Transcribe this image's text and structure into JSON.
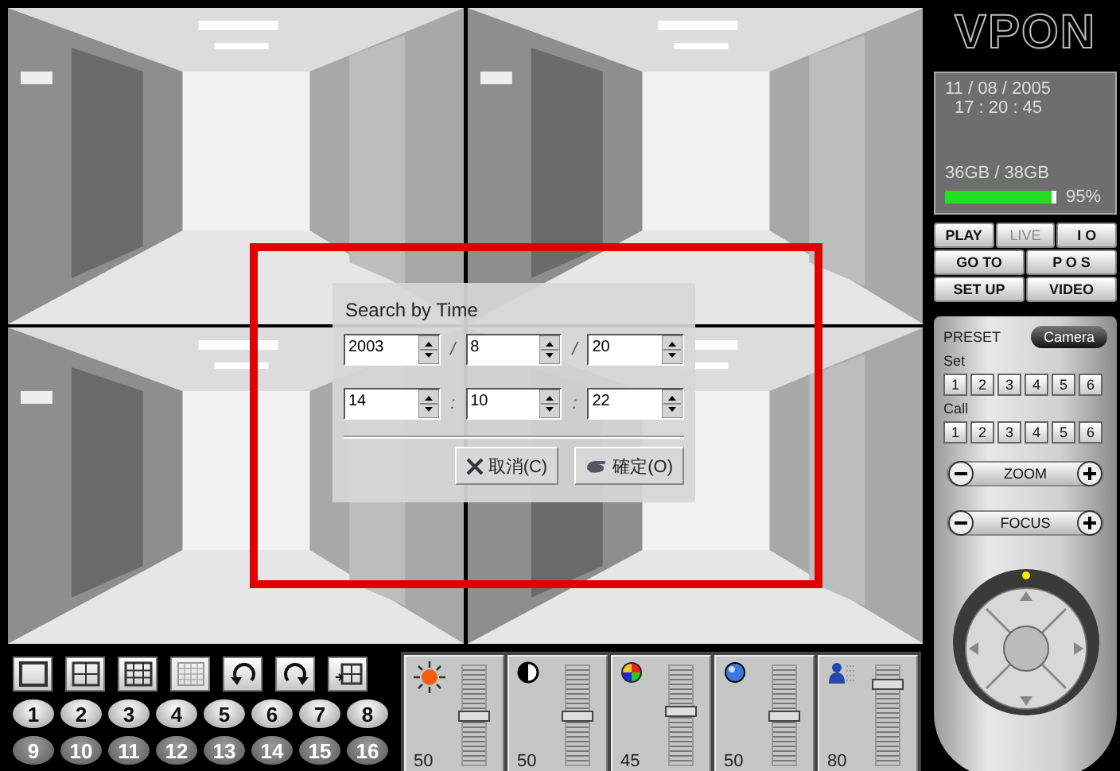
{
  "dialog": {
    "title": "Search by Time",
    "date_fields": [
      "2003",
      "8",
      "20"
    ],
    "date_separators": [
      "/",
      "/"
    ],
    "time_fields": [
      "14",
      "10",
      "22"
    ],
    "time_separators": [
      ":",
      ":"
    ],
    "buttons": [
      {
        "label": "取消(C)",
        "kind": "cancel"
      },
      {
        "label": "確定(O)",
        "kind": "ok"
      }
    ]
  },
  "layout_buttons": [
    {
      "kind": "single",
      "disabled": false
    },
    {
      "kind": "quad",
      "disabled": false
    },
    {
      "kind": "nine",
      "disabled": false
    },
    {
      "kind": "sixteen",
      "disabled": true
    },
    {
      "kind": "rotate-left",
      "disabled": false
    },
    {
      "kind": "rotate-right",
      "disabled": false
    },
    {
      "kind": "pip",
      "disabled": false
    }
  ],
  "channels": [
    {
      "label": "1",
      "disabled": false
    },
    {
      "label": "2",
      "disabled": false
    },
    {
      "label": "3",
      "disabled": false
    },
    {
      "label": "4",
      "disabled": false
    },
    {
      "label": "5",
      "disabled": false
    },
    {
      "label": "6",
      "disabled": false
    },
    {
      "label": "7",
      "disabled": false
    },
    {
      "label": "8",
      "disabled": false
    },
    {
      "label": "9",
      "disabled": true
    },
    {
      "label": "10",
      "disabled": true
    },
    {
      "label": "11",
      "disabled": true
    },
    {
      "label": "12",
      "disabled": true
    },
    {
      "label": "13",
      "disabled": true
    },
    {
      "label": "14",
      "disabled": true
    },
    {
      "label": "15",
      "disabled": true
    },
    {
      "label": "16",
      "disabled": true
    }
  ],
  "adjustments": [
    {
      "kind": "brightness",
      "value": "50",
      "level": 0.5
    },
    {
      "kind": "contrast",
      "value": "50",
      "level": 0.5
    },
    {
      "kind": "color",
      "value": "45",
      "level": 0.55
    },
    {
      "kind": "hue",
      "value": "50",
      "level": 0.5
    },
    {
      "kind": "sharpness",
      "value": "80",
      "level": 0.85
    }
  ],
  "logo": "VPON",
  "status": {
    "date": "11 / 08 / 2005",
    "time": "17 : 20 : 45",
    "storage": "36GB / 38GB",
    "usage": {
      "level": 0.95
    },
    "usage_label": "95%"
  },
  "mode_rows": [
    {
      "buttons": [
        {
          "label": "PLAY",
          "disabled": false
        },
        {
          "label": "LIVE",
          "disabled": true
        },
        {
          "label": "I O",
          "disabled": false
        }
      ]
    },
    {
      "buttons": [
        {
          "label": "GO TO",
          "disabled": false
        },
        {
          "label": "P O S",
          "disabled": false
        }
      ]
    },
    {
      "buttons": [
        {
          "label": "SET UP",
          "disabled": false
        },
        {
          "label": "VIDEO",
          "disabled": false
        }
      ]
    }
  ],
  "ptz": {
    "preset_label": "PRESET",
    "camera_button": "Camera",
    "set_label": "Set",
    "set_buttons": [
      "1",
      "2",
      "3",
      "4",
      "5",
      "6"
    ],
    "call_label": "Call",
    "call_buttons": [
      "1",
      "2",
      "3",
      "4",
      "5",
      "6"
    ],
    "lens_controls": [
      "ZOOM",
      "FOCUS"
    ]
  }
}
